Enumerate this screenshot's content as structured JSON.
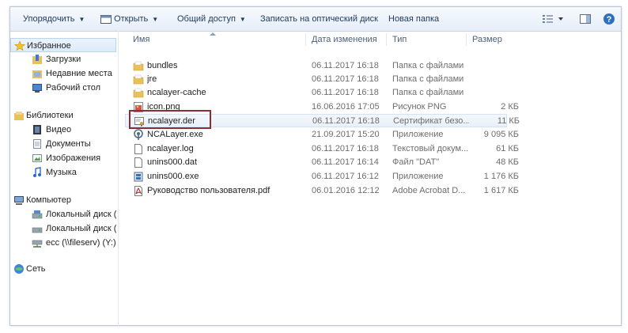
{
  "toolbar": {
    "organize": "Упорядочить",
    "open": "Открыть",
    "share": "Общий доступ",
    "burn": "Записать на оптический диск",
    "new_folder": "Новая папка"
  },
  "nav": {
    "favorites": "Избранное",
    "downloads": "Загрузки",
    "recent": "Недавние места",
    "desktop": "Рабочий стол",
    "libraries": "Библиотеки",
    "video": "Видео",
    "documents": "Документы",
    "pictures": "Изображения",
    "music": "Музыка",
    "computer": "Компьютер",
    "disk_c": "Локальный диск (C",
    "disk_d": "Локальный диск (D",
    "network_drive": "ecc (\\\\fileserv) (Y:)",
    "network": "Сеть"
  },
  "columns": {
    "name": "Имя",
    "date": "Дата изменения",
    "type": "Тип",
    "size": "Размер"
  },
  "files": [
    {
      "name": "bundles",
      "date": "06.11.2017 16:18",
      "type": "Папка с файлами",
      "size": "",
      "icon": "folder-icon"
    },
    {
      "name": "jre",
      "date": "06.11.2017 16:18",
      "type": "Папка с файлами",
      "size": "",
      "icon": "folder-icon"
    },
    {
      "name": "ncalayer-cache",
      "date": "06.11.2017 16:18",
      "type": "Папка с файлами",
      "size": "",
      "icon": "folder-icon"
    },
    {
      "name": "icon.png",
      "date": "16.06.2016 17:05",
      "type": "Рисунок PNG",
      "size": "2 КБ",
      "icon": "image-icon"
    },
    {
      "name": "ncalayer.der",
      "date": "06.11.2017 16:18",
      "type": "Сертификат безо...",
      "size": "11 КБ",
      "icon": "certificate-icon"
    },
    {
      "name": "NCALayer.exe",
      "date": "21.09.2017 15:20",
      "type": "Приложение",
      "size": "9 095 КБ",
      "icon": "app-icon"
    },
    {
      "name": "ncalayer.log",
      "date": "06.11.2017 16:18",
      "type": "Текстовый докум...",
      "size": "61 КБ",
      "icon": "text-file-icon"
    },
    {
      "name": "unins000.dat",
      "date": "06.11.2017 16:14",
      "type": "Файл \"DAT\"",
      "size": "48 КБ",
      "icon": "file-icon"
    },
    {
      "name": "unins000.exe",
      "date": "06.11.2017 16:12",
      "type": "Приложение",
      "size": "1 176 КБ",
      "icon": "installer-icon"
    },
    {
      "name": "Руководство пользователя.pdf",
      "date": "06.01.2016 12:12",
      "type": "Adobe Acrobat D...",
      "size": "1 617 КБ",
      "icon": "pdf-icon"
    }
  ],
  "colors": {
    "toolbar_text": "#1e395b",
    "highlight_box": "#8d2d33",
    "folder": "#e8c15a"
  }
}
